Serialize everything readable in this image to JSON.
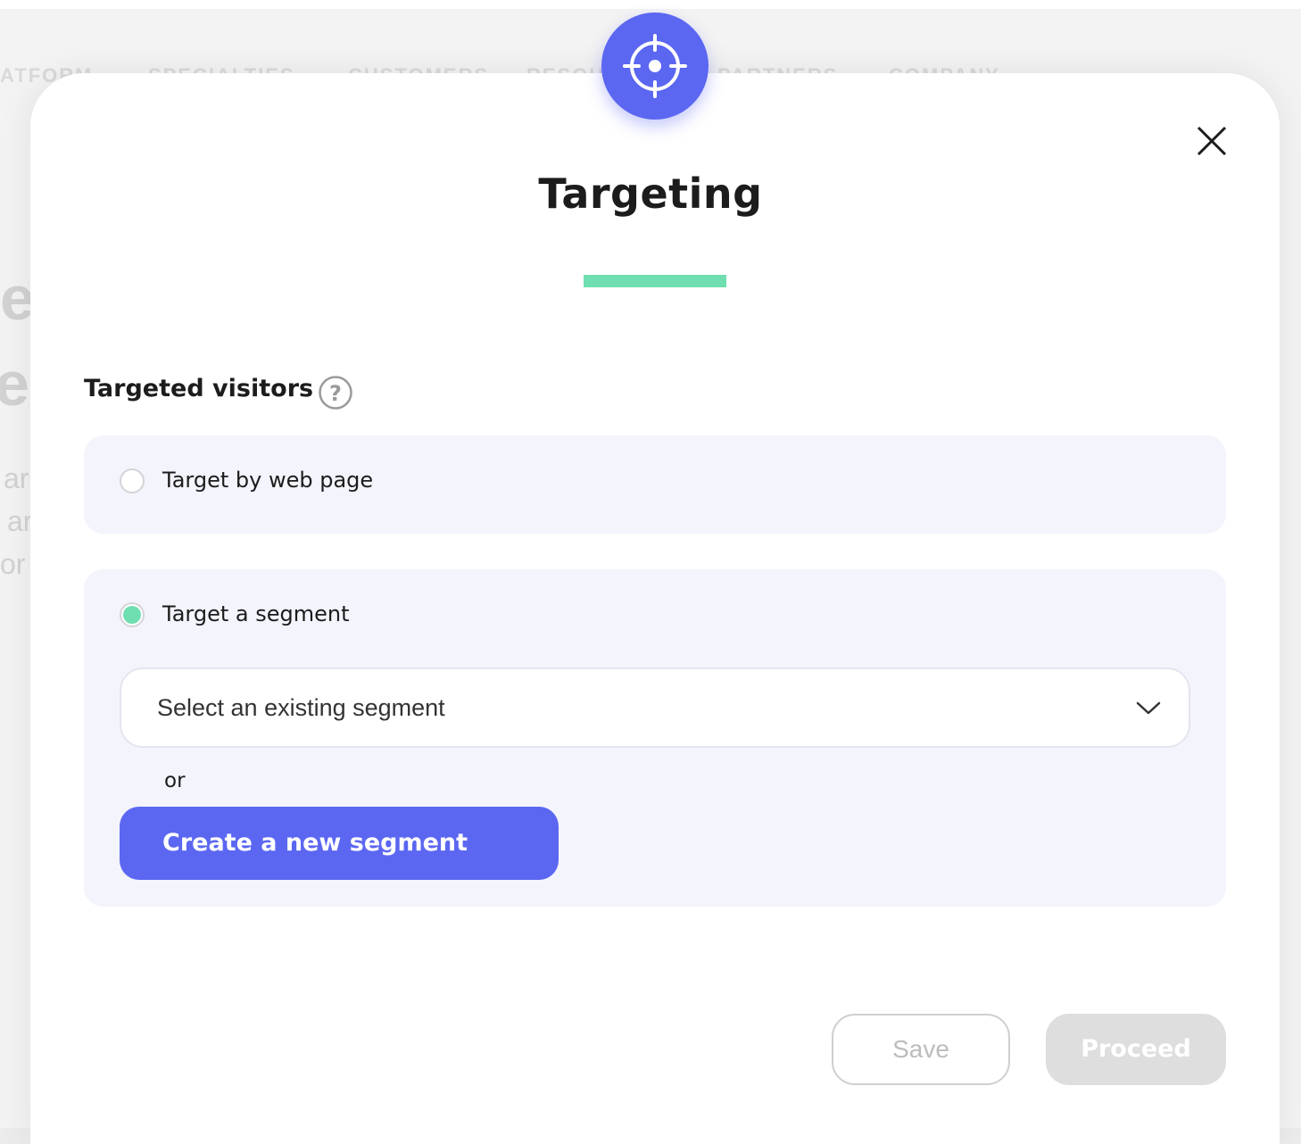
{
  "background": {
    "nav_items": [
      "ATFORM",
      "SPECIALTIES",
      "CUSTOMERS",
      "RESOU",
      "PARTNERS",
      "COMPANY"
    ],
    "left_fragments": [
      "e",
      "e",
      "ar",
      "ar",
      "or"
    ]
  },
  "modal": {
    "badge_icon": "crosshair-target-icon",
    "close_icon": "close-icon",
    "title": "Targeting",
    "accent_color": "#6fdeb0",
    "brand_color": "#5b67f1",
    "section_label": "Targeted visitors",
    "help_icon": "question-circle-icon",
    "options": {
      "web_page": {
        "label": "Target by web page",
        "selected": false
      },
      "segment": {
        "label": "Target a segment",
        "selected": true
      }
    },
    "segment_select": {
      "value": "Select an existing segment",
      "icon": "chevron-down-icon"
    },
    "or_text": "or",
    "create_button": "Create a new segment",
    "save_button": "Save",
    "proceed_button": "Proceed"
  }
}
